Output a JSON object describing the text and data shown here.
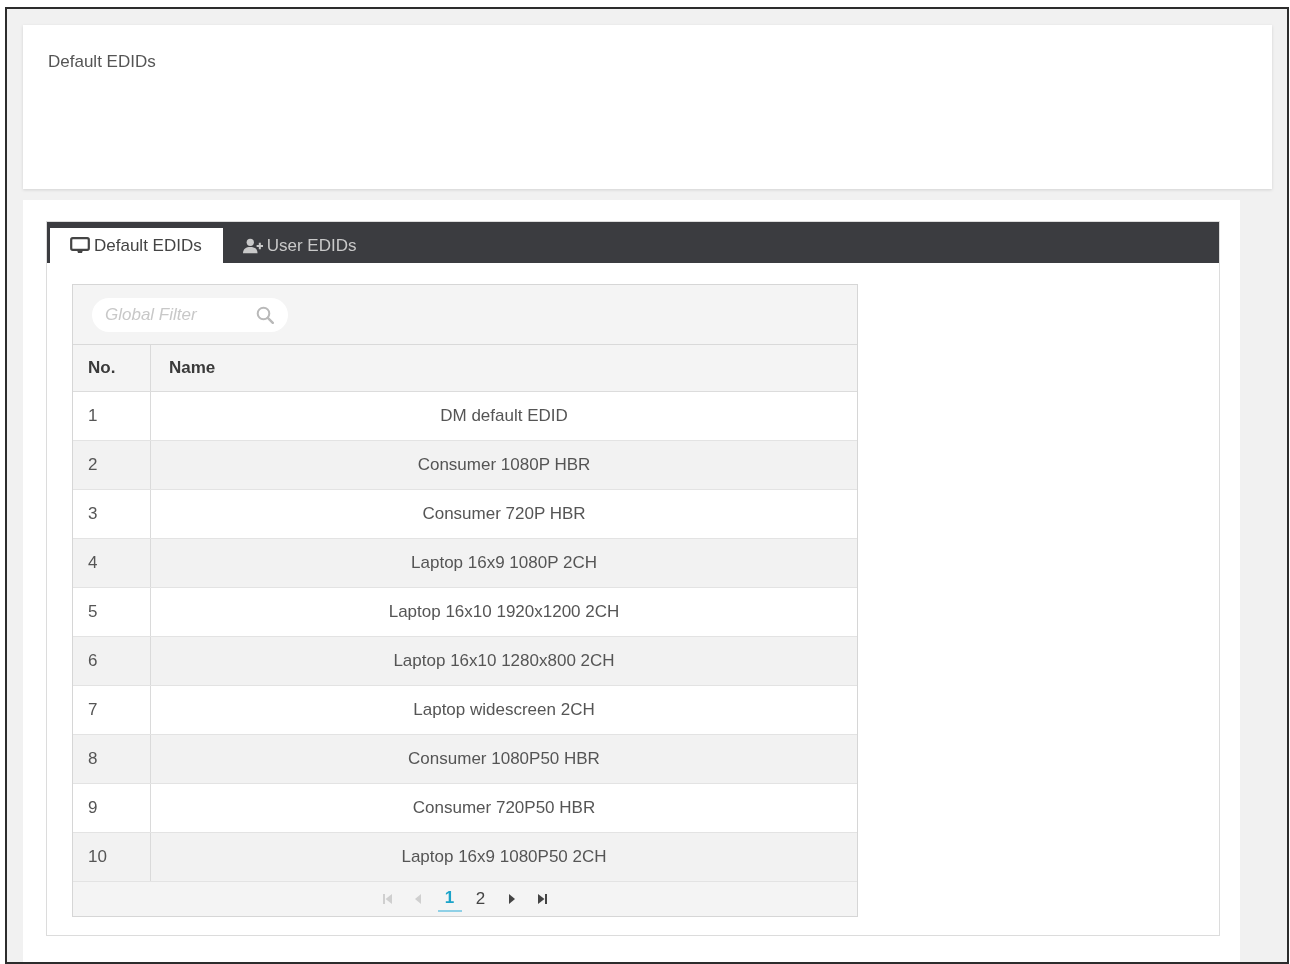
{
  "header_card": {
    "title": "Default EDIDs"
  },
  "tabs": [
    {
      "label": "Default EDIDs",
      "selected": true
    },
    {
      "label": "User EDIDs",
      "selected": false
    }
  ],
  "filter": {
    "placeholder": "Global Filter"
  },
  "table": {
    "columns": [
      "No.",
      "Name"
    ],
    "rows": [
      [
        "1",
        "DM default EDID"
      ],
      [
        "2",
        "Consumer 1080P HBR"
      ],
      [
        "3",
        "Consumer 720P HBR"
      ],
      [
        "4",
        "Laptop 16x9 1080P 2CH"
      ],
      [
        "5",
        "Laptop 16x10 1920x1200 2CH"
      ],
      [
        "6",
        "Laptop 16x10 1280x800 2CH"
      ],
      [
        "7",
        "Laptop widescreen 2CH"
      ],
      [
        "8",
        "Consumer 1080P50 HBR"
      ],
      [
        "9",
        "Consumer 720P50 HBR"
      ],
      [
        "10",
        "Laptop 16x9 1080P50 2CH"
      ]
    ]
  },
  "paginator": {
    "nav": [
      {
        "kind": "first",
        "disabled": true
      },
      {
        "kind": "previous",
        "disabled": true
      },
      {
        "kind": "next",
        "disabled": false
      },
      {
        "kind": "last",
        "disabled": false
      }
    ],
    "pages": [
      {
        "label": "1",
        "selected": true
      },
      {
        "label": "2",
        "selected": false
      }
    ]
  }
}
